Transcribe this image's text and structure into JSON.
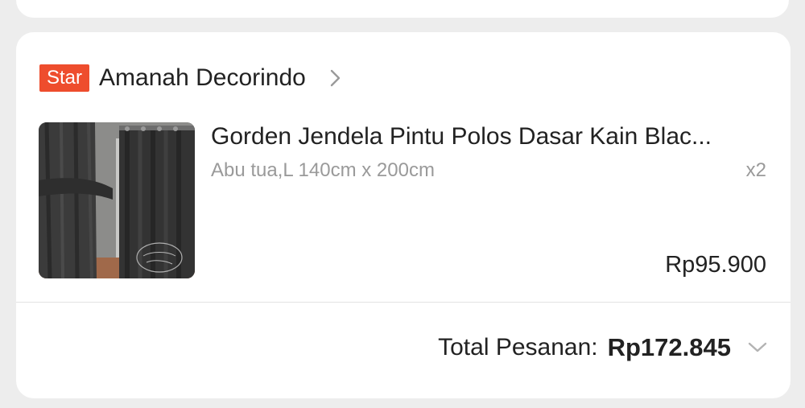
{
  "order": {
    "shop": {
      "badge": "Star",
      "name": "Amanah Decorindo",
      "chevron_icon": "chevron-right-icon"
    },
    "item": {
      "name": "Gorden Jendela Pintu Polos Dasar Kain Blac...",
      "variant": "Abu tua,L 140cm x 200cm",
      "quantity": "x2",
      "price": "Rp95.900",
      "thumbnail_watermark": "Amanah Decorindo"
    },
    "total": {
      "label": "Total Pesanan:",
      "value": "Rp172.845",
      "chevron_icon": "chevron-down-icon"
    }
  },
  "colors": {
    "star_badge": "#ee4d2d",
    "background": "#ededed",
    "card": "#ffffff",
    "muted_text": "#9a9a9a"
  }
}
